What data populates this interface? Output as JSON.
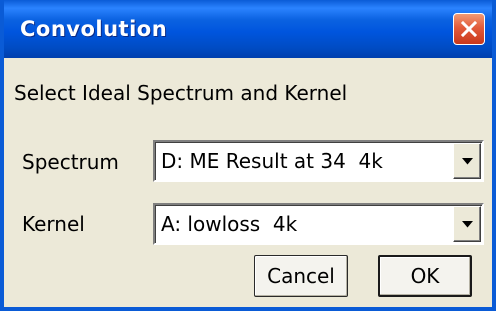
{
  "window": {
    "title": "Convolution"
  },
  "dialog": {
    "instruction": "Select Ideal Spectrum and Kernel",
    "spectrum": {
      "label": "Spectrum",
      "selected": "D: ME Result at 34  4k"
    },
    "kernel": {
      "label": "Kernel",
      "selected": "A: lowloss  4k"
    },
    "buttons": {
      "cancel": "Cancel",
      "ok": "OK"
    }
  },
  "icons": {
    "close": "close-icon",
    "dropdown": "chevron-down-icon"
  },
  "colors": {
    "titlebar": "#0055de",
    "frame": "#0a5bd6",
    "dialog_background": "#ece9d8",
    "close_button": "#e25b3b"
  }
}
